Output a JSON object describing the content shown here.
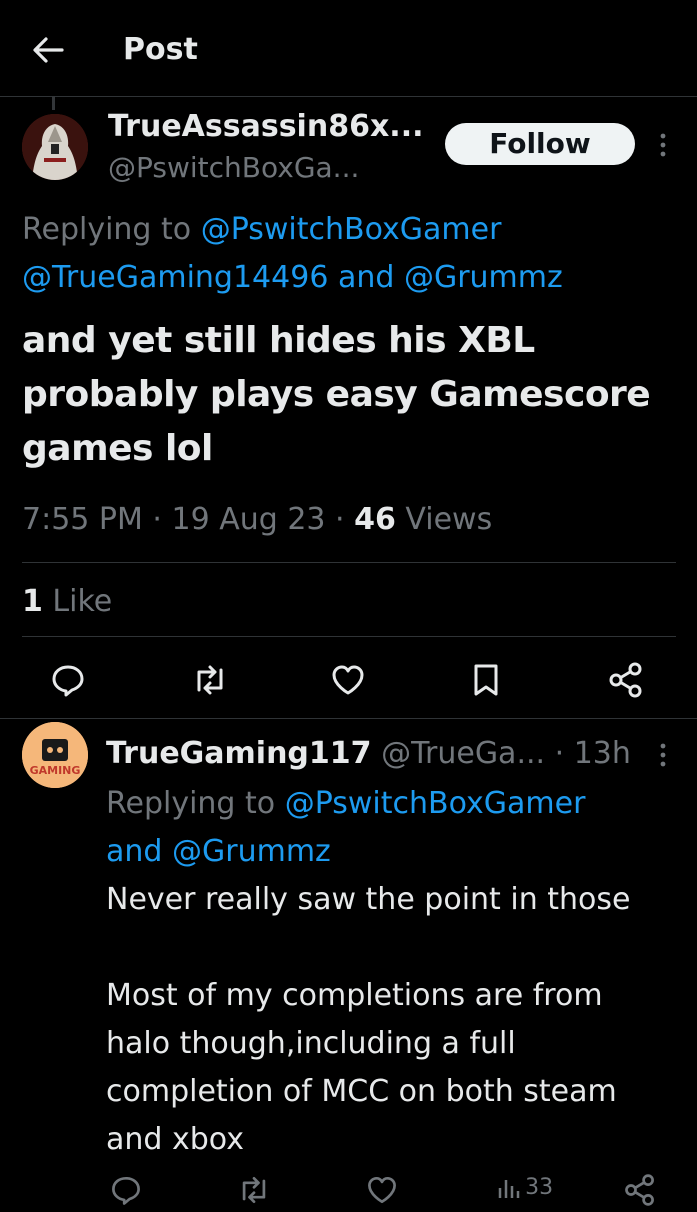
{
  "header": {
    "title": "Post"
  },
  "main_post": {
    "display_name": "TrueAssassin86x...",
    "handle": "@PswitchBoxGa...",
    "follow_label": "Follow",
    "replying_prefix": "Replying to",
    "replying_handles": [
      "@PswitchBoxGamer",
      "@TrueGaming14496",
      "@Grummz"
    ],
    "replying_and": "and",
    "text_lines": [
      "and yet still hides his XBL",
      "probably plays easy Gamescore",
      "games lol"
    ],
    "time": "7:55 PM",
    "date": "19 Aug 23",
    "views_count": "46",
    "views_label": "Views",
    "likes_count": "1",
    "likes_label": "Like",
    "actions": [
      "reply-icon",
      "retweet-icon",
      "like-icon",
      "bookmark-icon",
      "share-icon"
    ]
  },
  "reply": {
    "display_name": "TrueGaming117",
    "handle": "@TrueGa...",
    "time": "13h",
    "avatar_text": "GAMING",
    "replying_prefix": "Replying to",
    "replying_handles": [
      "@PswitchBoxGamer",
      "@Grummz"
    ],
    "replying_and": "and",
    "text_lines": [
      "Never really saw the point in those",
      "",
      "Most of my completions are from",
      "halo though,including a full",
      "completion of MCC on both steam",
      "and xbox"
    ],
    "views_count": "33",
    "actions": [
      "reply-icon",
      "retweet-icon",
      "like-icon",
      "views-icon",
      "share-icon"
    ]
  },
  "colors": {
    "background": "#000000",
    "text": "#e7e9ea",
    "muted": "#71767b",
    "link": "#1d9bf0",
    "divider": "#2f3336"
  }
}
